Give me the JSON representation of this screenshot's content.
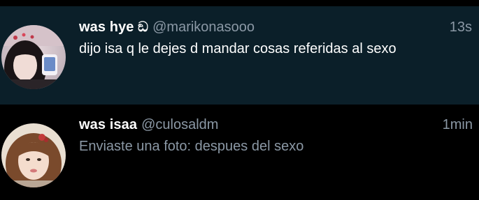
{
  "conversations": [
    {
      "name": "was hye ඞ",
      "handle": "@marikonasooo",
      "time": "13s",
      "message": "dijo isa q le dejes d mandar cosas referidas al sexo",
      "unread": true,
      "avatar_icon": "user-avatar-photo"
    },
    {
      "name": "was isaa",
      "handle": "@culosaldm",
      "time": "1min",
      "message": "Enviaste una foto: despues del sexo",
      "unread": false,
      "avatar_icon": "user-avatar-photo"
    }
  ],
  "colors": {
    "unread_row_bg": "#0b1f29",
    "read_row_bg": "#000000",
    "primary_text": "#ffffff",
    "secondary_text": "#8b98a5"
  }
}
